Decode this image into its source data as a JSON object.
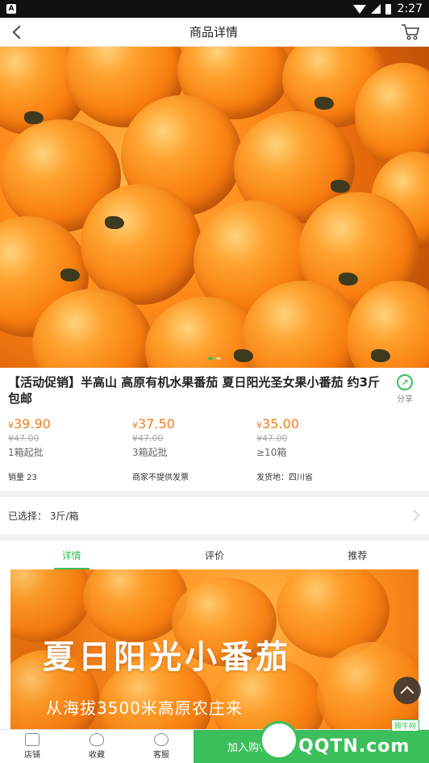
{
  "status_bar": {
    "time": "2:27",
    "notif_icon": "A"
  },
  "header": {
    "title": "商品详情"
  },
  "product": {
    "name": "【活动促销】半高山 高原有机水果番茄 夏日阳光圣女果小番茄 约3斤包邮",
    "share_label": "分享",
    "tiers": [
      {
        "currency": "¥",
        "price": "39.90",
        "old_price": "¥47.00",
        "min_qty": "1箱起批"
      },
      {
        "currency": "¥",
        "price": "37.50",
        "old_price": "¥47.00",
        "min_qty": "3箱起批"
      },
      {
        "currency": "¥",
        "price": "35.00",
        "old_price": "¥47.00",
        "min_qty": "≥10箱"
      }
    ],
    "meta": {
      "sales": "销量 23",
      "invoice": "商家不提供发票",
      "ship_from": "发货地：四川省"
    },
    "price_color": "#f07c1c"
  },
  "selection": {
    "text": "已选择：  3斤/箱"
  },
  "tabs": [
    {
      "label": "详情",
      "active": true
    },
    {
      "label": "评价",
      "active": false
    },
    {
      "label": "推荐",
      "active": false
    }
  ],
  "banner": {
    "title": "夏日阳光小番茄",
    "subtitle": "从海拔3500米高原农庄来"
  },
  "bottom_bar": {
    "store": "店铺",
    "favorite": "收藏",
    "service": "客服",
    "add_to_cart": "加入购物"
  },
  "watermark": {
    "text": "QQTN.com",
    "tag": "腾牛网"
  },
  "accent_color": "#3bbf5a"
}
